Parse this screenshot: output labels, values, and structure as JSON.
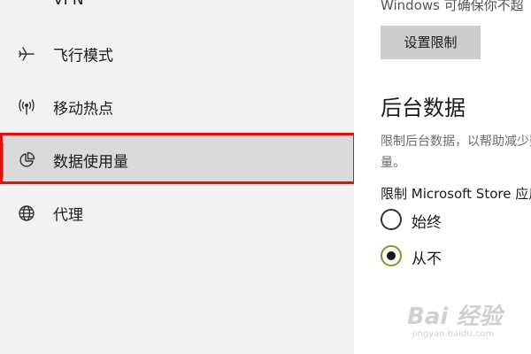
{
  "sidebar": {
    "partial_top_label": "VPN",
    "items": [
      {
        "label": "飞行模式",
        "icon": "airplane-icon"
      },
      {
        "label": "移动热点",
        "icon": "hotspot-icon"
      },
      {
        "label": "数据使用量",
        "icon": "pie-chart-icon",
        "selected": true
      },
      {
        "label": "代理",
        "icon": "globe-icon"
      }
    ]
  },
  "content": {
    "partial_top_text": "Windows 可确保你不超",
    "set_limit_button": "设置限制",
    "background_data": {
      "title": "后台数据",
      "description": "限制后台数据，以帮助减少数据使用量。",
      "store_label": "限制 Microsoft Store 应用",
      "options": [
        {
          "label": "始终",
          "checked": false
        },
        {
          "label": "从不",
          "checked": true
        }
      ]
    }
  },
  "watermark": {
    "brand": "Bai 经验",
    "url": "jingyan.baidu.com"
  },
  "colors": {
    "accent": "#7a9a2a",
    "highlight_border": "#e01010",
    "sidebar_bg": "#f2f2f2",
    "selected_bg": "#dadada",
    "button_bg": "#cccccc"
  }
}
